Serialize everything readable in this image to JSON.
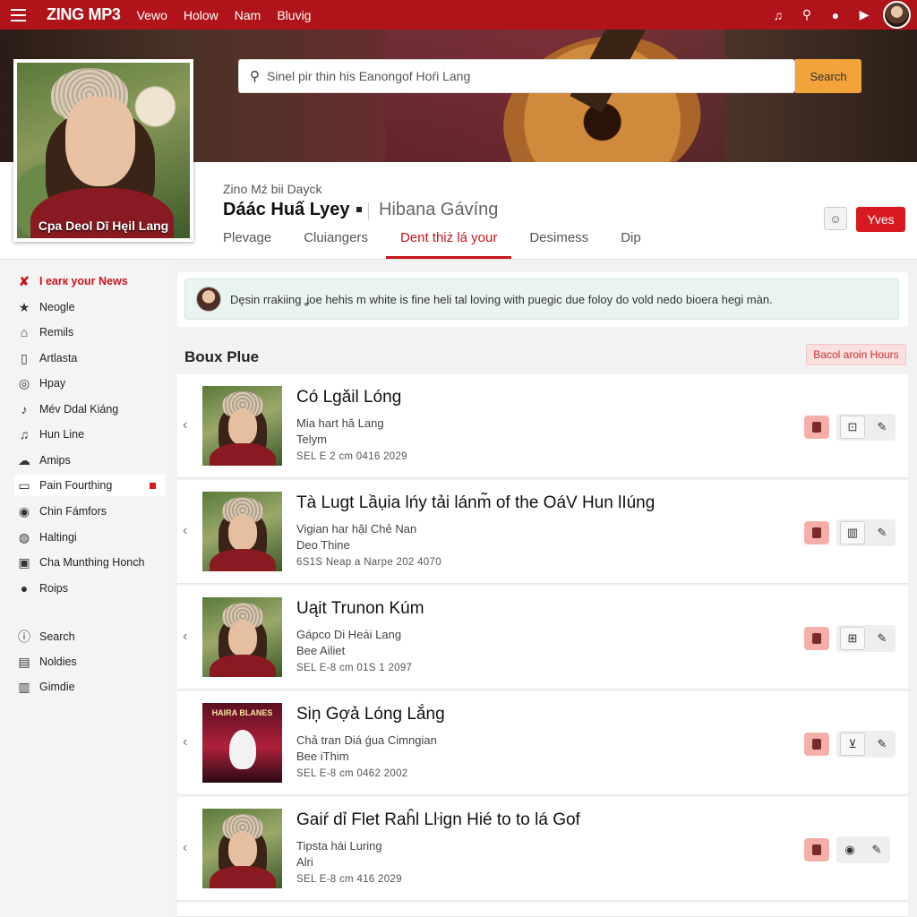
{
  "topbar": {
    "logo": "ZING MP3",
    "nav": [
      "Vewo",
      "Holow",
      "Nam",
      "Bluvig"
    ]
  },
  "search": {
    "value": "Sinel pir thin his Eanongof Hoŕi Lang",
    "button": "Search"
  },
  "profile": {
    "caption": "Cpa Deol Dī Hęil Lang"
  },
  "artist": {
    "subtitle": "Zino Mź bii Dayck",
    "name": "Dáác Huấ Lyey",
    "alt_name": "Hibana Gávíng",
    "follow_label": "Yves",
    "tabs": [
      {
        "label": "Plevage",
        "active": false
      },
      {
        "label": "Cluiangers",
        "active": false
      },
      {
        "label": "Dent thiż lá your",
        "active": true
      },
      {
        "label": "Desimess",
        "active": false
      },
      {
        "label": "Dip",
        "active": false
      }
    ]
  },
  "sidebar": {
    "items": [
      {
        "icon": "x-mark-icon",
        "label": "I earк your News"
      },
      {
        "icon": "star-icon",
        "label": "Neogle"
      },
      {
        "icon": "home-icon",
        "label": "Remils"
      },
      {
        "icon": "book-icon",
        "label": "Artlasta"
      },
      {
        "icon": "compass-icon",
        "label": "Hpay"
      },
      {
        "icon": "hand-icon",
        "label": "Mév Ddal Kiáng"
      },
      {
        "icon": "music-note-icon",
        "label": "Hun Line"
      },
      {
        "icon": "cloud-icon",
        "label": "Amips"
      },
      {
        "icon": "card-icon",
        "label": "Pain Fourthing"
      },
      {
        "icon": "disc-icon",
        "label": "Chin Fámfors"
      },
      {
        "icon": "radio-icon",
        "label": "Haltingi"
      },
      {
        "icon": "grid-icon",
        "label": "Cha Munthing Honch"
      },
      {
        "icon": "user-icon",
        "label": "Roips"
      },
      {
        "icon": "info-icon",
        "label": "Search"
      },
      {
        "icon": "list-icon",
        "label": "Noldies"
      },
      {
        "icon": "columns-icon",
        "label": "Gimdie"
      }
    ]
  },
  "notice": {
    "text": "Dęsin rrakiing ʝoe hehis m white is fine heli tal loving with puegic due foloy do vold nedo bioera hegi màn."
  },
  "section": {
    "title": "Boux Plue",
    "action": "Bacol aroin Hours"
  },
  "songs": [
    {
      "title": "Có Lgăil Lóng",
      "sub1": "Mia hart hă Lang",
      "sub2": "Telym",
      "meta": "SEL E 2 cm 0416 2029",
      "thumb": "portrait"
    },
    {
      "title": "Tà Lugt Lầụia lńy tải lánm̃ of the OáV Hun lIúng",
      "sub1": "Vigian har hặl Chẻ Nan",
      "sub2": "Deo Thine",
      "meta": "6S1S Neap a Narpe 202 4070",
      "thumb": "portrait"
    },
    {
      "title": "Uąit Trunon Kúm",
      "sub1": "Gápco Di Heái Lang",
      "sub2": "Bee Ailiet",
      "meta": "SEL E-8 cm 01S 1 2097",
      "thumb": "portrait"
    },
    {
      "title": "Siņ Gợả Lóng Lắng",
      "sub1": "Chả tran Diá ǵua Cimngian",
      "sub2": "Bee iThim",
      "meta": "SEL E-8 cm 0462 2002",
      "thumb": "poster",
      "poster_title": "HAIRA BLANES"
    },
    {
      "title": "Gaiŕ dỉ Flet Raĥl Lŀign Hié to to lá Gof",
      "sub1": "Tipsta hái Luring",
      "sub2": "Alri",
      "meta": "SEL E-8 cm 416 2029",
      "thumb": "portrait"
    }
  ],
  "colors": {
    "brand": "#b0141a",
    "accent": "#f2a33a",
    "active_tab": "#c8141c"
  }
}
